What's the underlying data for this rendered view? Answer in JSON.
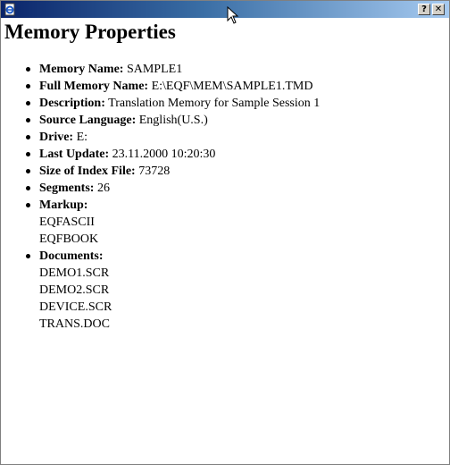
{
  "heading": "Memory Properties",
  "properties": {
    "memory_name": {
      "label": "Memory Name:",
      "value": "SAMPLE1"
    },
    "full_memory_name": {
      "label": "Full Memory Name:",
      "value": "E:\\EQF\\MEM\\SAMPLE1.TMD"
    },
    "description": {
      "label": "Description:",
      "value": "Translation Memory for Sample Session 1"
    },
    "source_language": {
      "label": "Source Language:",
      "value": "English(U.S.)"
    },
    "drive": {
      "label": "Drive:",
      "value": "E:"
    },
    "last_update": {
      "label": "Last Update:",
      "value": "23.11.2000 10:20:30"
    },
    "index_size": {
      "label": "Size of Index File:",
      "value": "73728"
    },
    "segments": {
      "label": "Segments:",
      "value": "26"
    },
    "markup": {
      "label": "Markup:",
      "items": [
        "EQFASCII",
        "EQFBOOK"
      ]
    },
    "documents": {
      "label": "Documents:",
      "items": [
        "DEMO1.SCR",
        "DEMO2.SCR",
        "DEVICE.SCR",
        "TRANS.DOC"
      ]
    }
  },
  "titlebar": {
    "help_label": "?",
    "close_label": "✕"
  },
  "icons": {
    "app": "ie-document-icon",
    "help": "help-icon",
    "close": "close-icon",
    "cursor": "mouse-pointer-icon"
  },
  "colors": {
    "titlebar_start": "#0a246a",
    "titlebar_end": "#a6caf0",
    "button_face": "#d4d0c8"
  }
}
